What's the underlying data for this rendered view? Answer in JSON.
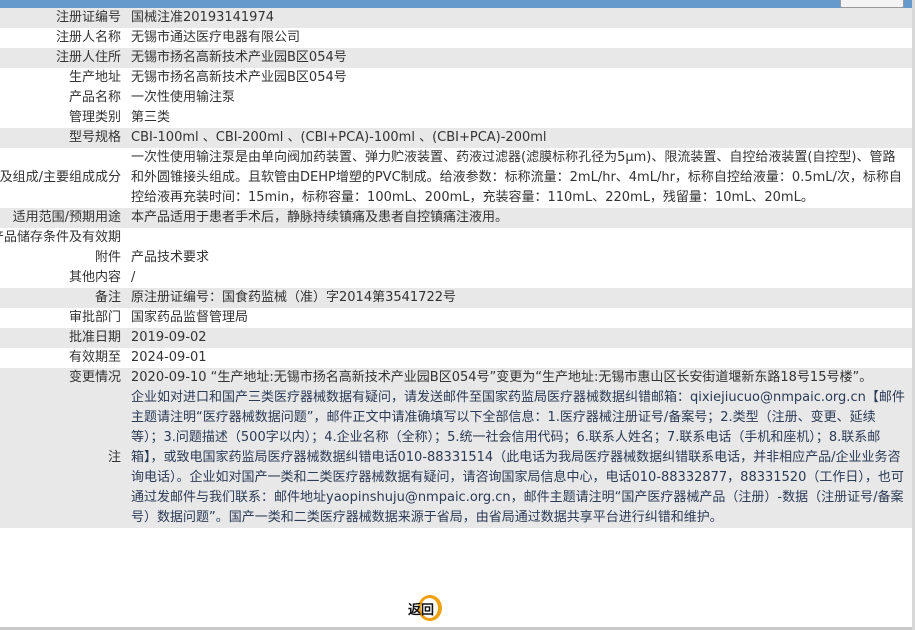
{
  "header": {
    "title": ""
  },
  "rows": [
    {
      "label": "注册证编号",
      "value": "国械注准20193141974",
      "bg": "g"
    },
    {
      "label": "注册人名称",
      "value": "无锡市通达医疗电器有限公司",
      "bg": "w"
    },
    {
      "label": "注册人住所",
      "value": "无锡市扬名高新技术产业园B区054号",
      "bg": "g"
    },
    {
      "label": "生产地址",
      "value": "无锡市扬名高新技术产业园B区054号",
      "bg": "w"
    },
    {
      "label": "产品名称",
      "value": "一次性使用输注泵",
      "bg": "w"
    },
    {
      "label": "管理类别",
      "value": "第三类",
      "bg": "w"
    },
    {
      "label": "型号规格",
      "value": "CBI-100ml 、CBI-200ml 、(CBI+PCA)-100ml 、(CBI+PCA)-200ml",
      "bg": "g"
    },
    {
      "label": "结构及组成/主要组成成分",
      "value": "一次性使用输注泵是由单向阀加药装置、弹力贮液装置、药液过滤器(滤膜标称孔径为5μm)、限流装置、自控给液装置(自控型)、管路和外圆锥接头组成。且软管由DEHP增塑的PVC制成。给液参数：标称流量：2mL/hr、4mL/hr，标称自控给液量：0.5mL/次，标称自控给液再充装时间：15min，标称容量：100mL、200mL，充装容量：110mL、220mL，残留量：10mL、20mL。",
      "bg": "w"
    },
    {
      "label": "适用范围/预期用途",
      "value": "本产品适用于患者手术后，静脉持续镇痛及患者自控镇痛注液用。",
      "bg": "g"
    },
    {
      "label": "产品储存条件及有效期",
      "value": "",
      "bg": "w"
    },
    {
      "label": "附件",
      "value": "产品技术要求",
      "bg": "w"
    },
    {
      "label": "其他内容",
      "value": "/",
      "bg": "w"
    },
    {
      "label": "备注",
      "value": "原注册证编号：国食药监械（准）字2014第3541722号",
      "bg": "g"
    },
    {
      "label": "审批部门",
      "value": "国家药品监督管理局",
      "bg": "w"
    },
    {
      "label": "批准日期",
      "value": "2019-09-02",
      "bg": "g"
    },
    {
      "label": "有效期至",
      "value": "2024-09-01",
      "bg": "w"
    },
    {
      "label": "变更情况",
      "value": "2020-09-10 “生产地址:无锡市扬名高新技术产业园B区054号”变更为“生产地址:无锡市惠山区长安街道堰新东路18号15号楼”。",
      "bg": "g"
    }
  ],
  "note": {
    "label": "注",
    "value": "企业如对进口和国产三类医疗器械数据有疑问，请发送邮件至国家药监局医疗器械数据纠错邮箱：qixiejiucuo@nmpaic.org.cn【邮件主题请注明“医疗器械数据问题”，邮件正文中请准确填写以下全部信息：1.医疗器械注册证号/备案号；2.类型（注册、变更、延续等）；3.问题描述（500字以内）；4.企业名称（全称）；5.统一社会信用代码；6.联系人姓名；7.联系电话（手机和座机）；8.联系邮箱】，或致电国家药监局医疗器械数据纠错电话010-88331514（此电话为我局医疗器械数据纠错联系电话，并非相应产品/企业业务咨询电话）。企业如对国产一类和二类医疗器械数据有疑问，请咨询国家局信息中心，电话010-88332877，88331520（工作日），也可通过发邮件与我们联系：邮件地址yaopinshuju@nmpaic.org.cn，邮件主题请注明“国产医疗器械产品（注册）-数据（注册证号/备案号）数据问题”。国产一类和二类医疗器械数据来源于省局，由省局通过数据共享平台进行纠错和维护。"
  },
  "back_button": {
    "label": "返回",
    "accent": "#f0a010"
  },
  "colors": {
    "header": "#6699cc",
    "row_alt": "#e8e8e8"
  }
}
